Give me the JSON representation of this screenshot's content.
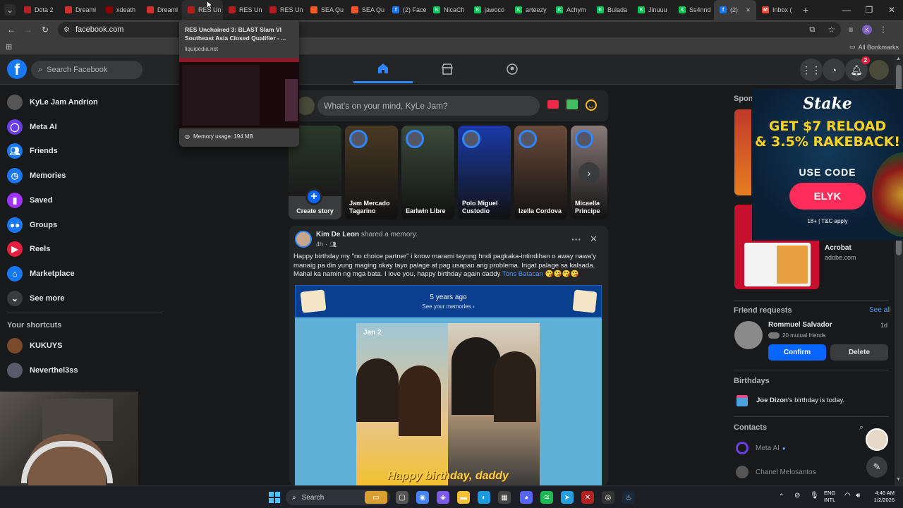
{
  "browser": {
    "tabs": [
      {
        "label": "Dota 2",
        "fav_color": "#b22222",
        "glyph": ""
      },
      {
        "label": "Dreaml",
        "fav_color": "#d32f2f",
        "glyph": ""
      },
      {
        "label": "xdeath",
        "fav_color": "#8b0000",
        "glyph": ""
      },
      {
        "label": "Dreaml",
        "fav_color": "#d32f2f",
        "glyph": ""
      },
      {
        "label": "RES Un",
        "fav_color": "#b71c1c",
        "glyph": ""
      },
      {
        "label": "RES Un",
        "fav_color": "#b71c1c",
        "glyph": ""
      },
      {
        "label": "RES Un",
        "fav_color": "#b71c1c",
        "glyph": ""
      },
      {
        "label": "SEA Qu",
        "fav_color": "#ff5722",
        "glyph": ""
      },
      {
        "label": "SEA Qu",
        "fav_color": "#ff5722",
        "glyph": ""
      },
      {
        "label": "(2) Face",
        "fav_color": "#1877f2",
        "glyph": "f"
      },
      {
        "label": "NicaCh",
        "fav_color": "#00c853",
        "glyph": "K"
      },
      {
        "label": "jawoco",
        "fav_color": "#00c853",
        "glyph": "K"
      },
      {
        "label": "arteezy",
        "fav_color": "#00c853",
        "glyph": "K"
      },
      {
        "label": "Achym",
        "fav_color": "#00c853",
        "glyph": "K"
      },
      {
        "label": "Bulada",
        "fav_color": "#00c853",
        "glyph": "K"
      },
      {
        "label": "Jinuuu",
        "fav_color": "#00c853",
        "glyph": "K"
      },
      {
        "label": "Ss4nnd",
        "fav_color": "#00c853",
        "glyph": "K"
      },
      {
        "label": "(2)",
        "fav_color": "#1877f2",
        "glyph": "f"
      },
      {
        "label": "Inbox (",
        "fav_color": "#ea4335",
        "glyph": "M"
      }
    ],
    "url": "facebook.com",
    "all_bookmarks": "All Bookmarks",
    "profile_initial": "K",
    "tooltip": {
      "title": "RES Unchained 3: BLAST Slam VI Southeast Asia Closed Qualifier - ...",
      "domain": "liquipedia.net",
      "memory": "Memory usage: 194 MB"
    }
  },
  "facebook": {
    "search_placeholder": "Search Facebook",
    "notification_count": "2",
    "left_nav": [
      {
        "label": "KyLe Jam Andrion",
        "icon": "avatar",
        "color": "#555"
      },
      {
        "label": "Meta AI",
        "icon": "meta-ai-icon",
        "color": "#6a3de8"
      },
      {
        "label": "Friends",
        "icon": "friends-icon",
        "color": "#1877f2"
      },
      {
        "label": "Memories",
        "icon": "memories-icon",
        "color": "#1877f2"
      },
      {
        "label": "Saved",
        "icon": "saved-icon",
        "color": "#a033ff"
      },
      {
        "label": "Groups",
        "icon": "groups-icon",
        "color": "#1877f2"
      },
      {
        "label": "Reels",
        "icon": "reels-icon",
        "color": "#e41e3f"
      },
      {
        "label": "Marketplace",
        "icon": "marketplace-icon",
        "color": "#1877f2"
      },
      {
        "label": "See more",
        "icon": "chevron-down-icon",
        "color": "#3a3b3c"
      }
    ],
    "shortcuts_title": "Your shortcuts",
    "shortcuts": [
      {
        "label": "KUKUYS",
        "color": "#7a4a2a"
      },
      {
        "label": "Neverthel3ss",
        "color": "#5a5a6a"
      }
    ],
    "composer_placeholder": "What's on your mind, KyLe Jam?",
    "stories": [
      {
        "label": "Create story",
        "color": "#3a3b3c"
      },
      {
        "label": "Jam Mercado Tagarino",
        "color": "#4a3a24"
      },
      {
        "label": "Earlwin Libre",
        "color": "#3b4a3a"
      },
      {
        "label": "Polo Miguel Custodio",
        "color": "#1a3aa8"
      },
      {
        "label": "Izella Cordova",
        "color": "#6a4a3a"
      },
      {
        "label": "Micaella Principe",
        "color": "#8a7a7a"
      }
    ],
    "post": {
      "author": "Kim De Leon",
      "action": "shared a memory.",
      "time": "4h",
      "text": "Happy birthday my \"no choice partner\" i know marami tayong hndi pagkaka-intindihan o away nawa'y manaig pa din yung maging okay tayo palage at pag usapan ang problema. Ingat palage sa kalsada. Mahal ka namin ng mga bata. I love you, happy birthday again daddy",
      "mention": "Tons Batacan",
      "emojis": "😘😘😘😘",
      "memory_years": "5 years ago",
      "see_memories": "See your memories ›",
      "photo_date": "Jan 2",
      "photo_caption": "Happy birthday, daddy"
    },
    "right": {
      "sponsored": "Sponsored",
      "ad2_title": "Acrobat",
      "ad2_domain": "adobe.com",
      "friend_requests": "Friend requests",
      "see_all": "See all",
      "request_name": "Rommuel Salvador",
      "request_mutual": "20 mutual friends",
      "request_time": "1d",
      "confirm": "Confirm",
      "delete": "Delete",
      "birthdays": "Birthdays",
      "birthday_name": "Joe Dizon",
      "birthday_text": "'s birthday is today.",
      "contacts": "Contacts",
      "contact1": "Meta AI",
      "contact2": "Chanel Melosantos"
    },
    "stake_ad": {
      "brand": "Stake",
      "line1": "GET $7 RELOAD",
      "line2": "& 3.5% RAKEBACK!",
      "use_code": "USE CODE",
      "code": "ELYK",
      "terms": "18+ | T&C apply"
    }
  },
  "taskbar": {
    "search": "Search",
    "lang1": "ENG",
    "lang2": "INTL",
    "time": "4:46 AM",
    "date": "1/2/2026"
  }
}
